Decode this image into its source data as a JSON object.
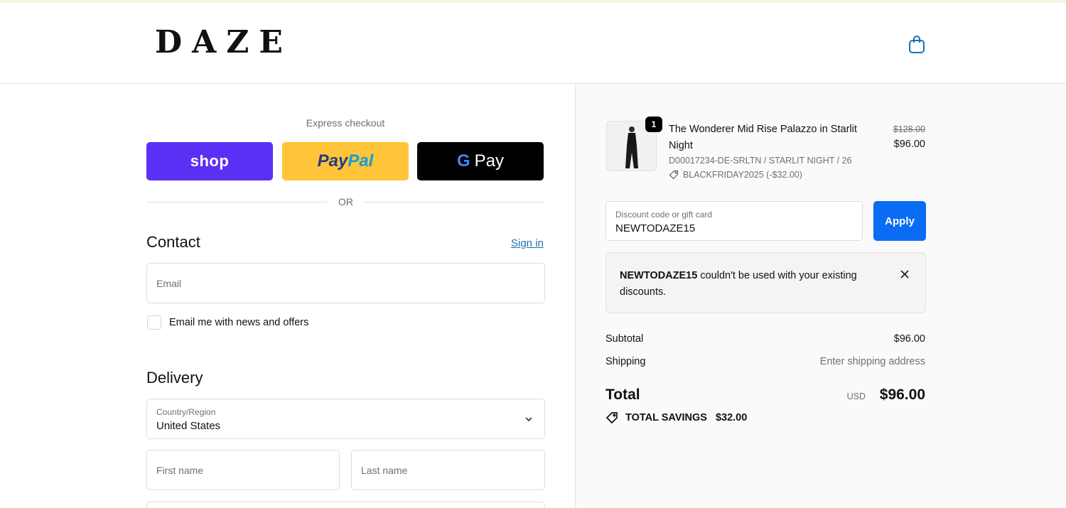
{
  "brand": {
    "logo": "DAZE"
  },
  "header": {
    "cart_icon": "shopping-bag-icon",
    "accent": "#1773b0"
  },
  "express": {
    "label": "Express checkout",
    "shop_label": "shop",
    "paypal_label_1": "Pay",
    "paypal_label_2": "Pal",
    "gpay_g": "G",
    "gpay_label": "Pay",
    "or": "OR"
  },
  "contact": {
    "title": "Contact",
    "sign_in": "Sign in",
    "email_placeholder": "Email",
    "newsletter_label": "Email me with news and offers"
  },
  "delivery": {
    "title": "Delivery",
    "country_label": "Country/Region",
    "country_value": "United States",
    "first_name_placeholder": "First name",
    "last_name_placeholder": "Last name"
  },
  "order": {
    "quantity": "1",
    "product_name": "The Wonderer Mid Rise Palazzo in Starlit Night",
    "variant": "D00017234-DE-SRLTN / STARLIT NIGHT / 26",
    "discount_applied": "BLACKFRIDAY2025 (-$32.00)",
    "price_original": "$128.00",
    "price_current": "$96.00"
  },
  "discount": {
    "label": "Discount code or gift card",
    "value": "NEWTODAZE15",
    "apply": "Apply",
    "error_code": "NEWTODAZE15",
    "error_message": " couldn't be used with your existing discounts."
  },
  "summary": {
    "subtotal_label": "Subtotal",
    "subtotal_value": "$96.00",
    "shipping_label": "Shipping",
    "shipping_value": "Enter shipping address",
    "total_label": "Total",
    "total_currency": "USD",
    "total_value": "$96.00",
    "savings_label": "TOTAL SAVINGS",
    "savings_value": "$32.00"
  },
  "colors": {
    "shop": "#5a31f4",
    "paypal": "#ffc439",
    "gpay": "#000000",
    "apply": "#0a6cf5",
    "link": "#1773b0"
  }
}
